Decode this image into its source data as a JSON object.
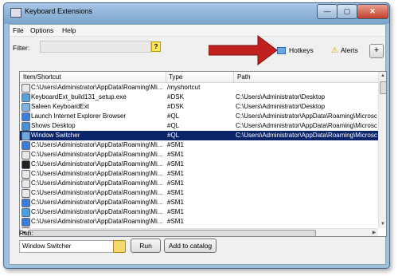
{
  "window": {
    "title": "Keyboard Extensions",
    "controls": {
      "minimize": "—",
      "maximize": "▢",
      "close": "✕"
    }
  },
  "menu": [
    "File",
    "Options",
    "Help"
  ],
  "filter": {
    "label": "Filter:",
    "value": "",
    "help_icon": "?"
  },
  "toolbar": {
    "hotkeys_label": "Hotkeys",
    "alerts_label": "Alerts",
    "add_label": "+"
  },
  "annotation": {
    "arrow_color": "#c0201e"
  },
  "list": {
    "columns": [
      "Item/Shortcut",
      "Type",
      "Path"
    ],
    "rows": [
      {
        "item": "C:\\Users\\Administrator\\AppData\\Roaming\\Mi...",
        "type": "/myshortcut",
        "path": "",
        "icon": "doc-icon"
      },
      {
        "item": "KeyboardExt_build131_setup.exe",
        "type": "#DSK",
        "path": "C:\\Users\\Administrator\\Desktop",
        "icon": "installer-icon"
      },
      {
        "item": "Saleen KeyboardExt",
        "type": "#DSK",
        "path": "C:\\Users\\Administrator\\Desktop",
        "icon": "app-icon"
      },
      {
        "item": "Launch Internet Explorer Browser",
        "type": "#QL",
        "path": "C:\\Users\\Administrator\\AppData\\Roaming\\Microsc",
        "icon": "ie-icon"
      },
      {
        "item": "Shows Desktop",
        "type": "#QL",
        "path": "C:\\Users\\Administrator\\AppData\\Roaming\\Microsc",
        "icon": "desktop-icon"
      },
      {
        "item": "Window Switcher",
        "type": "#QL",
        "path": "C:\\Users\\Administrator\\AppData\\Roaming\\Microsc",
        "icon": "window-icon",
        "selected": true
      },
      {
        "item": "C:\\Users\\Administrator\\AppData\\Roaming\\Mi...",
        "type": "#SM1",
        "path": "",
        "icon": "ie-icon"
      },
      {
        "item": "C:\\Users\\Administrator\\AppData\\Roaming\\Mi...",
        "type": "#SM1",
        "path": "",
        "icon": "doc-icon"
      },
      {
        "item": "C:\\Users\\Administrator\\AppData\\Roaming\\Mi...",
        "type": "#SM1",
        "path": "",
        "icon": "cmd-icon"
      },
      {
        "item": "C:\\Users\\Administrator\\AppData\\Roaming\\Mi...",
        "type": "#SM1",
        "path": "",
        "icon": "doc-icon"
      },
      {
        "item": "C:\\Users\\Administrator\\AppData\\Roaming\\Mi...",
        "type": "#SM1",
        "path": "",
        "icon": "doc-icon"
      },
      {
        "item": "C:\\Users\\Administrator\\AppData\\Roaming\\Mi...",
        "type": "#SM1",
        "path": "",
        "icon": "doc-icon"
      },
      {
        "item": "C:\\Users\\Administrator\\AppData\\Roaming\\Mi...",
        "type": "#SM1",
        "path": "",
        "icon": "ie-icon"
      },
      {
        "item": "C:\\Users\\Administrator\\AppData\\Roaming\\Mi...",
        "type": "#SM1",
        "path": "",
        "icon": "monitor-icon"
      },
      {
        "item": "C:\\Users\\Administrator\\AppData\\Roaming\\Mi...",
        "type": "#SM1",
        "path": "",
        "icon": "ie-icon"
      },
      {
        "item": "C:\\Users\\Administrator\\AppData\\Roaming\\Mi...",
        "type": "#SM1",
        "path": "",
        "icon": "doc-icon"
      }
    ]
  },
  "run": {
    "label": "Run:",
    "value": "Window Switcher",
    "run_button": "Run",
    "catalog_button": "Add to catalog"
  },
  "colors": {
    "selection": "#0a246a",
    "title_bar": "#9dbfe0"
  }
}
